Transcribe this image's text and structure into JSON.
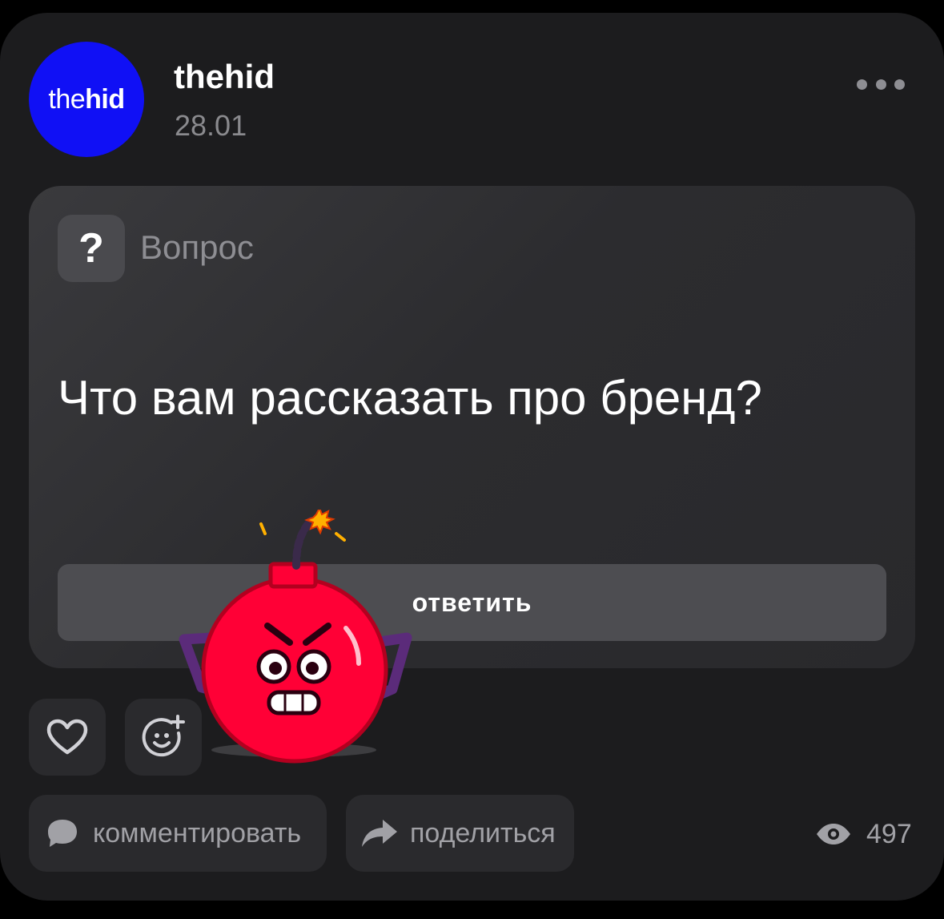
{
  "post": {
    "author": {
      "name": "thehid",
      "avatar_text_light": "the",
      "avatar_text_bold": "hid",
      "avatar_color": "#1010f5"
    },
    "date": "28.01",
    "more_icon": "more-horizontal-icon"
  },
  "question": {
    "badge_symbol": "?",
    "label": "Вопрос",
    "text": "Что вам рассказать про бренд?",
    "answer_button": "ответить"
  },
  "sticker": {
    "name": "angry-bomb-sticker",
    "color": "#ff0036"
  },
  "reactions": {
    "like_icon": "heart-icon",
    "emoji_icon": "add-emoji-icon"
  },
  "actions": {
    "comment": {
      "label": "комментировать",
      "icon": "comment-bubble-icon"
    },
    "share": {
      "label": "поделиться",
      "icon": "share-arrow-icon"
    }
  },
  "views": {
    "count": "497",
    "icon": "eye-icon"
  },
  "colors": {
    "background": "#000000",
    "card": "#1c1c1e",
    "question_card": "#2e2e31",
    "secondary_text": "#8e8e93"
  }
}
